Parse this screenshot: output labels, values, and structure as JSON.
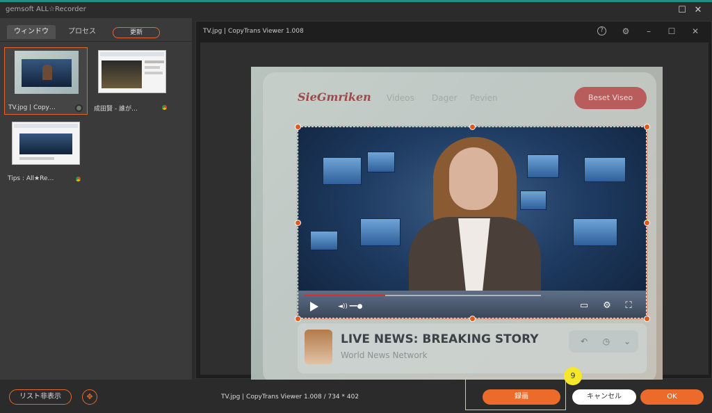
{
  "app": {
    "title": "gemsoft ALL☆Recorder"
  },
  "window_controls": {
    "maximize_icon": "☐",
    "close_icon": "✕"
  },
  "tabs": [
    {
      "label": "ウィンドウ",
      "active": true
    },
    {
      "label": "プロセス",
      "active": false
    }
  ],
  "refresh_label": "更新",
  "windows": [
    {
      "label": "TV.jpg | Copy…",
      "app_icon": "photo-viewer-icon",
      "selected": true
    },
    {
      "label": "成田賢 - 誰が…",
      "app_icon": "chrome-icon",
      "selected": false
    },
    {
      "label": "Tips : All★Re…",
      "app_icon": "chrome-icon",
      "selected": false
    }
  ],
  "viewer": {
    "title": "TV.jpg | CopyTrans Viewer 1.008",
    "controls": [
      "help-icon",
      "gear-icon",
      "minimize-icon",
      "maximize-icon",
      "close-icon"
    ]
  },
  "preview": {
    "logo": "SieGmriken",
    "nav": [
      "Videos",
      "Dager",
      "Pevien"
    ],
    "cta": "Beset Viseo",
    "video_progress": 0.34,
    "news_title": "LIVE NEWS: BREAKING STORY",
    "news_subtitle": "World News Network"
  },
  "bottom": {
    "hide_list_label": "リスト非表示",
    "status": "TV.jpg | CopyTrans Viewer 1.008 / 734 * 402",
    "record_label": "録画",
    "cancel_label": "キャンセル",
    "ok_label": "OK",
    "step_badge": "9"
  },
  "colors": {
    "accent": "#ec6a2a",
    "highlight": "#e8d92a",
    "badge": "#f5e82a"
  }
}
